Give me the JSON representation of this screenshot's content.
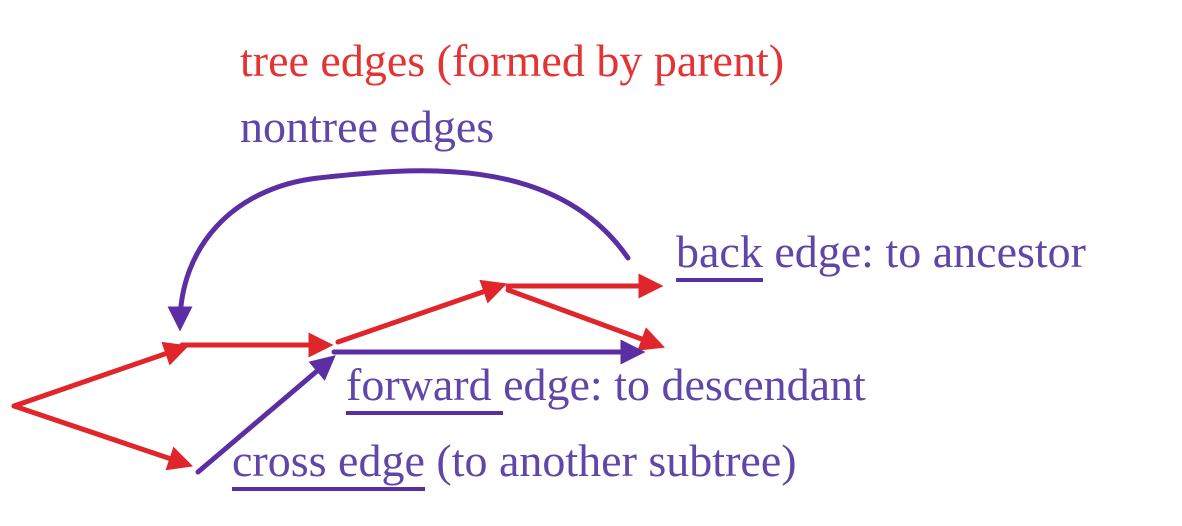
{
  "colors": {
    "tree": "#e0262b",
    "tree_text": "#e53232",
    "nontree": "#5b2ea3",
    "nontree_text": "#6046a8",
    "background": "#ffffff"
  },
  "legend": {
    "tree": "tree edges (formed by parent)",
    "nontree": "nontree edges"
  },
  "labels": {
    "back": {
      "keyword": "back",
      "rest": " edge: to ancestor"
    },
    "forward": {
      "keyword": "forward ",
      "rest": "edge: to descendant"
    },
    "cross": {
      "keyword": "cross edge",
      "rest": " (to another subtree)"
    }
  }
}
